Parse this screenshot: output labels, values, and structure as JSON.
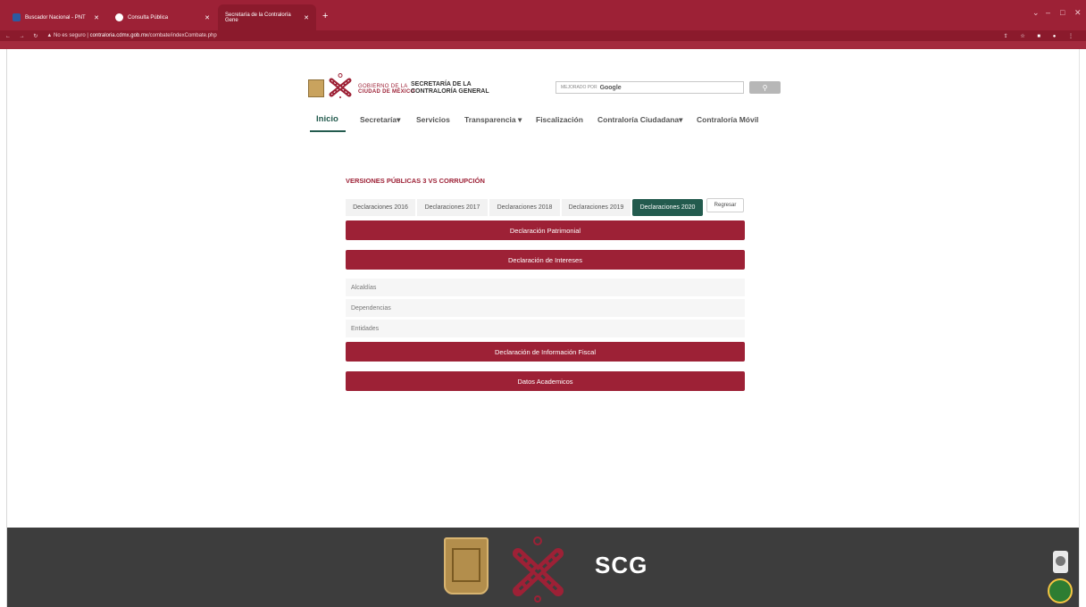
{
  "browser": {
    "tabs": [
      {
        "label": "Buscador Nacional - PNT",
        "active": false
      },
      {
        "label": "Consulta Pública",
        "active": false
      },
      {
        "label": "Secretaría de la Contraloría Gene",
        "active": true
      }
    ],
    "security_label": "No es seguro",
    "url_domain": "contraloria.cdmx.gob.mx",
    "url_path": "/combate/indexCombate.php"
  },
  "header": {
    "gov_line1": "GOBIERNO DE LA",
    "gov_line2": "CIUDAD DE MÉXICO",
    "sec_line1": "SECRETARÍA DE LA",
    "sec_line2": "CONTRALORÍA GENERAL",
    "search_prefix": "MEJORADO POR",
    "search_brand": "Google",
    "search_button_icon": "search-icon"
  },
  "nav": {
    "items": [
      "Inicio",
      "Secretaría",
      "Servicios",
      "Transparencia",
      "Fiscalización",
      "Contraloría Ciudadana",
      "Contraloría Móvil"
    ],
    "active": "Inicio"
  },
  "content": {
    "title": "VERSIONES PÚBLICAS 3 VS CORRUPCIÓN",
    "year_tabs": [
      "Declaraciones 2016",
      "Declaraciones 2017",
      "Declaraciones 2018",
      "Declaraciones 2019",
      "Declaraciones 2020"
    ],
    "active_tab": "Declaraciones 2020",
    "back_label": "Regresar",
    "sections": [
      "Declaración Patrimonial",
      "Declaración de Intereses",
      "Declaración de Información Fiscal",
      "Datos Academicos"
    ],
    "sub_items": [
      "Alcaldías",
      "Dependencias",
      "Entidades"
    ]
  },
  "footer": {
    "brand": "SCG"
  },
  "colors": {
    "guinda": "#9d2136",
    "verde": "#235b4e",
    "footer": "#3d3d3d"
  }
}
